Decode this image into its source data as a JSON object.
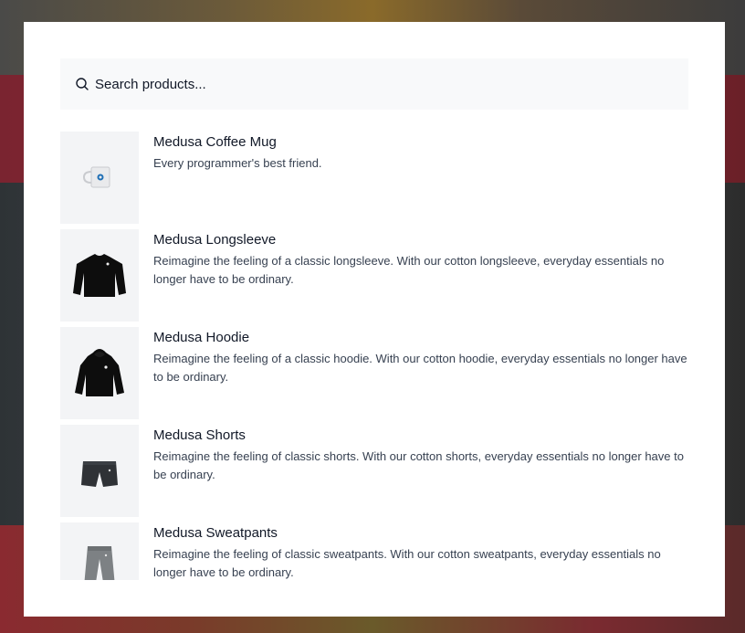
{
  "search": {
    "placeholder": "Search products...",
    "icon": "search-icon"
  },
  "products": [
    {
      "title": "Medusa Coffee Mug",
      "description": "Every programmer's best friend.",
      "icon": "coffee-mug-image"
    },
    {
      "title": "Medusa Longsleeve",
      "description": "Reimagine the feeling of a classic longsleeve. With our cotton longsleeve, everyday essentials no longer have to be ordinary.",
      "icon": "longsleeve-image"
    },
    {
      "title": "Medusa Hoodie",
      "description": "Reimagine the feeling of a classic hoodie. With our cotton hoodie, everyday essentials no longer have to be ordinary.",
      "icon": "hoodie-image"
    },
    {
      "title": "Medusa Shorts",
      "description": "Reimagine the feeling of classic shorts. With our cotton shorts, everyday essentials no longer have to be ordinary.",
      "icon": "shorts-image"
    },
    {
      "title": "Medusa Sweatpants",
      "description": "Reimagine the feeling of classic sweatpants. With our cotton sweatpants, everyday essentials no longer have to be ordinary.",
      "icon": "sweatpants-image"
    }
  ],
  "colors": {
    "modal_bg": "#ffffff",
    "search_bg": "#f8f9fa",
    "thumb_bg": "#f3f4f6",
    "text_primary": "#111827",
    "text_secondary": "#374151"
  }
}
